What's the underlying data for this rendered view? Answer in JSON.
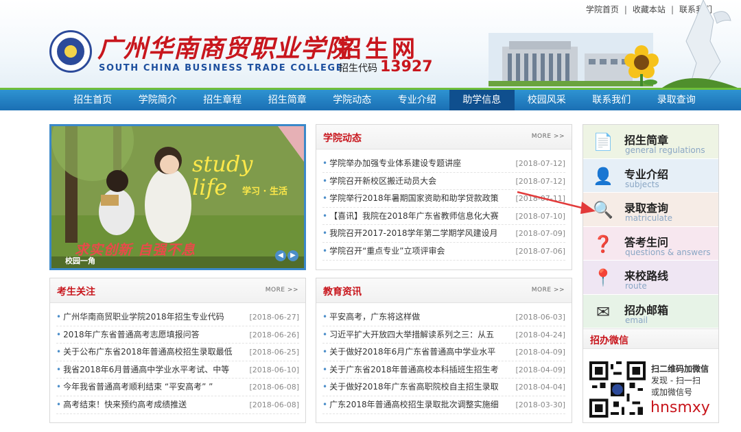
{
  "header": {
    "top_links": [
      "学院首页",
      "收藏本站",
      "联系我们"
    ],
    "top_sep": "|",
    "school_cn": "广州华南商贸职业学院",
    "school_en": "SOUTH CHINA BUSINESS TRADE COLLEGE",
    "site_name": "招生网",
    "code_label": "招生代码",
    "code_value": "13927"
  },
  "nav": {
    "items": [
      "招生首页",
      "学院简介",
      "招生章程",
      "招生简章",
      "学院动态",
      "专业介绍",
      "助学信息",
      "校园风采",
      "联系我们",
      "录取查询"
    ],
    "active_index": 6
  },
  "banner": {
    "study": "study",
    "life": "life",
    "sub": "学习 · 生活",
    "slogan": "求实创新 自强不息",
    "label": "校园一角",
    "prev": "◀",
    "next": "▶"
  },
  "panels": {
    "dynamics": {
      "title": "学院动态",
      "more": "MORE >>",
      "items": [
        {
          "text": "学院举办加强专业体系建设专题讲座",
          "date": "[2018-07-12]"
        },
        {
          "text": "学院召开新校区搬迁动员大会",
          "date": "[2018-07-12]"
        },
        {
          "text": "学院举行2018年暑期国家资助和助学贷款政策",
          "date": "[2018-07-11]"
        },
        {
          "text": "【喜讯】我院在2018年广东省教师信息化大赛",
          "date": "[2018-07-10]"
        },
        {
          "text": "我院召开2017-2018学年第二学期学风建设月",
          "date": "[2018-07-09]"
        },
        {
          "text": "学院召开“重点专业”立项评审会",
          "date": "[2018-07-06]"
        }
      ]
    },
    "candidates": {
      "title": "考生关注",
      "more": "MORE >>",
      "items": [
        {
          "text": "广州华南商贸职业学院2018年招生专业代码",
          "date": "[2018-06-27]"
        },
        {
          "text": "2018年广东省普通高考志愿填报问答",
          "date": "[2018-06-26]"
        },
        {
          "text": "关于公布广东省2018年普通高校招生录取最低",
          "date": "[2018-06-25]"
        },
        {
          "text": "我省2018年6月普通高中学业水平考试、中等",
          "date": "[2018-06-10]"
        },
        {
          "text": "今年我省普通高考顺利结束 “平安高考” ”",
          "date": "[2018-06-08]"
        },
        {
          "text": "高考结束！快来预约高考成绩推送",
          "date": "[2018-06-08]"
        }
      ]
    },
    "education": {
      "title": "教育资讯",
      "more": "MORE >>",
      "items": [
        {
          "text": "平安高考，广东将这样做",
          "date": "[2018-06-03]"
        },
        {
          "text": "习近平扩大开放四大举措解读系列之三：从五",
          "date": "[2018-04-24]"
        },
        {
          "text": "关于做好2018年6月广东省普通高中学业水平",
          "date": "[2018-04-09]"
        },
        {
          "text": "关于广东省2018年普通高校本科插班生招生考",
          "date": "[2018-04-09]"
        },
        {
          "text": "关于做好2018年广东省高职院校自主招生录取",
          "date": "[2018-04-04]"
        },
        {
          "text": "广东2018年普通高校招生录取批次调整实施细",
          "date": "[2018-03-30]"
        }
      ]
    }
  },
  "sidebar": {
    "items": [
      {
        "cn": "招生简章",
        "en": "general regulations",
        "bg": "#eef4e4"
      },
      {
        "cn": "专业介绍",
        "en": "subjects",
        "bg": "#e6eff7"
      },
      {
        "cn": "录取查询",
        "en": "matriculate",
        "bg": "#f6ece6"
      },
      {
        "cn": "答考生问",
        "en": "questions & answers",
        "bg": "#f7e7ef"
      },
      {
        "cn": "来校路线",
        "en": "route",
        "bg": "#efe6f3"
      },
      {
        "cn": "招办邮箱",
        "en": "email",
        "bg": "#e7f3e7"
      }
    ],
    "wechat_title": "招办微信",
    "wechat_line1": "扫二维码加微信",
    "wechat_line2": "发现 - 扫一扫",
    "wechat_line3": "或加微信号",
    "wechat_id": "hnsmxy"
  }
}
